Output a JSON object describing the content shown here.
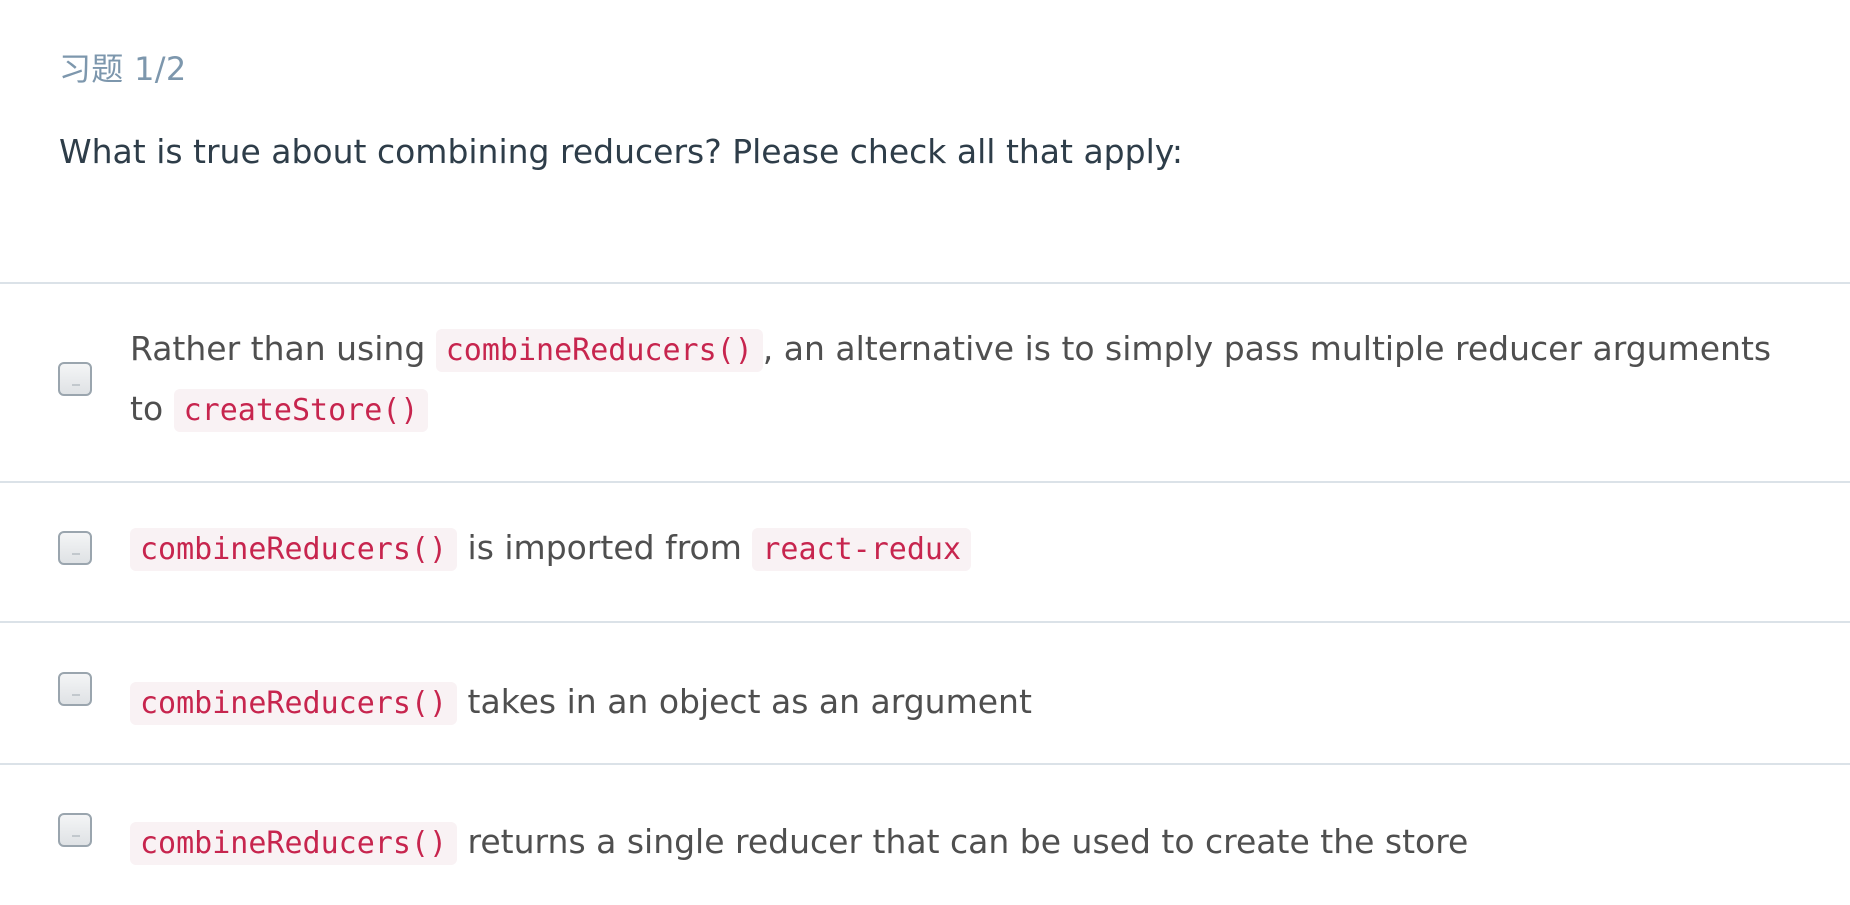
{
  "quiz": {
    "progress": "习题 1/2",
    "question": "What is true about combining reducers? Please check all that apply:"
  },
  "options": [
    {
      "code1": "combineReducers()",
      "text1": "Rather than using ",
      "text2": ", an alternative is to simply pass multiple reducer arguments to ",
      "code2": "createStore()",
      "checked": false
    },
    {
      "code1": "combineReducers()",
      "text1": " is imported from ",
      "code2": "react-redux",
      "checked": false
    },
    {
      "code1": "combineReducers()",
      "text1": " takes in an object as an argument",
      "checked": false
    },
    {
      "code1": "combineReducers()",
      "text1": " returns a single reducer that can be used to create the store",
      "checked": false
    }
  ],
  "colors": {
    "progress": "#7d97ad",
    "question": "#2e3d49",
    "option_text": "#4f4f4f",
    "code_text": "#c7254e",
    "code_bg": "#f9f2f4",
    "divider": "#dbe2e8"
  }
}
